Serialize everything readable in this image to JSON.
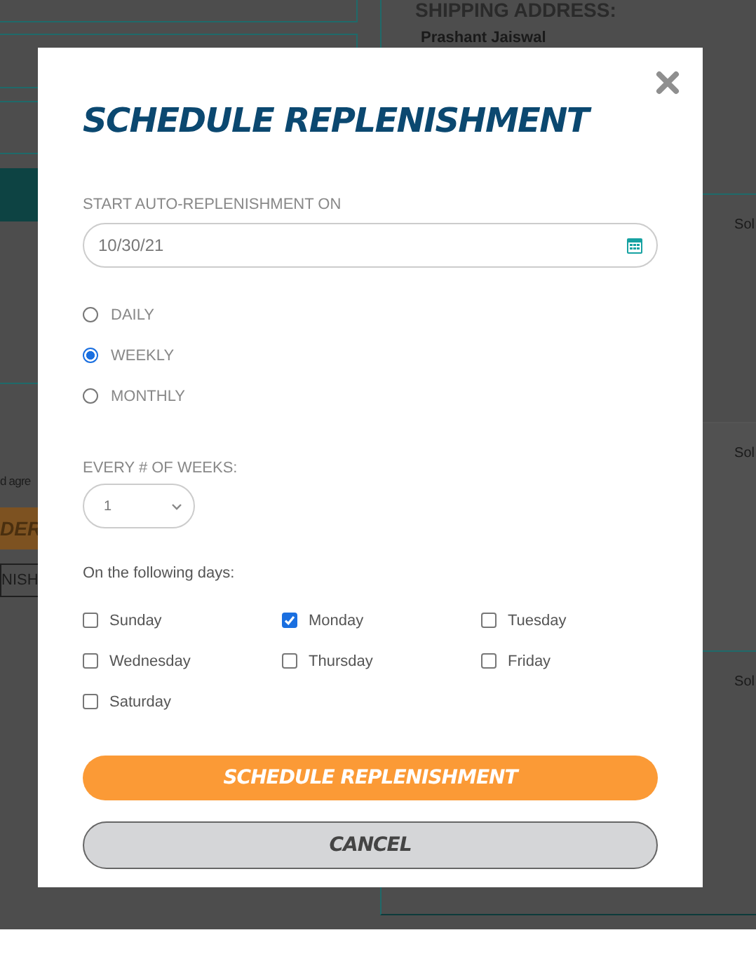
{
  "page_behind": {
    "agreement_text": "d agre",
    "order_button": "DER",
    "replenish_button": "NISH",
    "shipping_address": {
      "heading": "SHIPPING ADDRESS:",
      "name": "Prashant Jaiswal"
    },
    "items": [
      {
        "label": "Sol"
      },
      {
        "label": "Sol"
      },
      {
        "label": "Sol"
      }
    ]
  },
  "dialog": {
    "title": "SCHEDULE REPLENISHMENT",
    "start_date": {
      "label": "START AUTO-REPLENISHMENT ON",
      "value": "10/30/21"
    },
    "frequency": [
      {
        "label": "DAILY",
        "selected": false
      },
      {
        "label": "WEEKLY",
        "selected": true
      },
      {
        "label": "MONTHLY",
        "selected": false
      }
    ],
    "interval": {
      "label": "EVERY # OF WEEKS:",
      "value": "1"
    },
    "days_label": "On the following days:",
    "days": [
      {
        "label": "Sunday",
        "checked": false
      },
      {
        "label": "Monday",
        "checked": true
      },
      {
        "label": "Tuesday",
        "checked": false
      },
      {
        "label": "Wednesday",
        "checked": false
      },
      {
        "label": "Thursday",
        "checked": false
      },
      {
        "label": "Friday",
        "checked": false
      },
      {
        "label": "Saturday",
        "checked": false
      }
    ],
    "primary_button": "SCHEDULE REPLENISHMENT",
    "cancel_button": "CANCEL"
  }
}
